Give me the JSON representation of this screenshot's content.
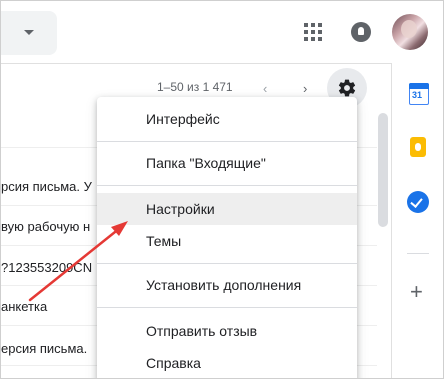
{
  "header": {
    "search_caret_icon": "caret-down-icon",
    "apps_icon": "apps-grid-icon",
    "notifications_icon": "bell-icon",
    "avatar_icon": "avatar"
  },
  "toolbar": {
    "pager": "1–50 из 1 471",
    "prev_icon": "‹",
    "next_icon": "›",
    "settings_icon": "gear-icon"
  },
  "emails": [
    {
      "snippet": "рсия письма. У"
    },
    {
      "snippet": "вую рабочую н"
    },
    {
      "snippet": "?123553209CN"
    },
    {
      "snippet": "анкетка"
    },
    {
      "snippet": "ерсия письма."
    }
  ],
  "menu": {
    "items": [
      {
        "label": "Интерфейс"
      },
      {
        "label": "Папка \"Входящие\""
      },
      {
        "label": "Настройки"
      },
      {
        "label": "Темы"
      },
      {
        "label": "Установить дополнения"
      },
      {
        "label": "Отправить отзыв"
      },
      {
        "label": "Справка"
      }
    ]
  },
  "sidepanel": {
    "calendar_day": "31",
    "add": "+"
  },
  "colors": {
    "arrow": "#e53935",
    "accent": "#1a73e8",
    "keep": "#fbbc04"
  }
}
